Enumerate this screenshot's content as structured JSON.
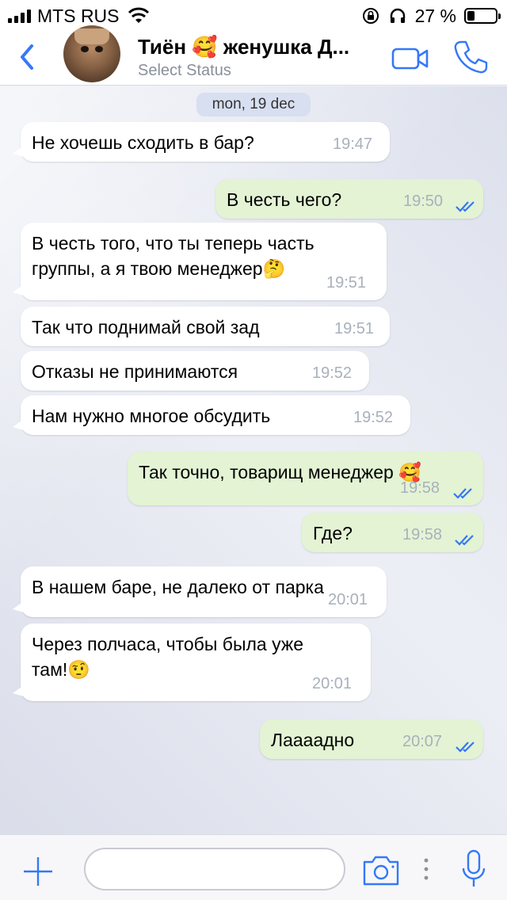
{
  "status_bar": {
    "carrier": "MTS RUS",
    "battery_percent": "27 %",
    "battery_level": 0.27,
    "icons": [
      "signal-icon",
      "wifi-icon",
      "rotation-lock-icon",
      "headphones-icon",
      "battery-icon"
    ]
  },
  "header": {
    "back_icon": "chevron-left-icon",
    "title": "Тиён 🥰 женушка Д...",
    "subtitle": "Select Status",
    "video_icon": "video-camera-icon",
    "call_icon": "phone-icon"
  },
  "chat": {
    "date_label": "mon, 19 dec",
    "messages": [
      {
        "direction": "in",
        "text": "Не хочешь сходить в бар?",
        "time": "19:47"
      },
      {
        "direction": "out",
        "text": "В честь чего?",
        "time": "19:50",
        "read": true
      },
      {
        "direction": "in",
        "text": "В честь того, что ты теперь часть\nгруппы, а я твою менеджер🤔",
        "time": "19:51"
      },
      {
        "direction": "in",
        "text": "Так что поднимай свой зад",
        "time": "19:51"
      },
      {
        "direction": "in",
        "text": "Отказы не принимаются",
        "time": "19:52"
      },
      {
        "direction": "in",
        "text": "Нам нужно многое обсудить",
        "time": "19:52"
      },
      {
        "direction": "out",
        "text": "Так точно, товарищ менеджер 🥰",
        "time": "19:58",
        "read": true
      },
      {
        "direction": "out",
        "text": "Где?",
        "time": "19:58",
        "read": true
      },
      {
        "direction": "in",
        "text": "В нашем баре, не далеко от парка",
        "time": "20:01"
      },
      {
        "direction": "in",
        "text": "Через полчаса, чтобы была уже\nтам!🤨",
        "time": "20:01"
      },
      {
        "direction": "out",
        "text": "Лаааадно",
        "time": "20:07",
        "read": true
      }
    ]
  },
  "input_bar": {
    "plus_icon": "plus-icon",
    "placeholder": "",
    "camera_icon": "camera-icon",
    "more_icon": "more-dots-icon",
    "mic_icon": "microphone-icon"
  },
  "colors": {
    "accent": "#3478f6",
    "incoming_bubble": "#ffffff",
    "outgoing_bubble": "#e3f3d4",
    "time_text": "#a9b0bc"
  }
}
